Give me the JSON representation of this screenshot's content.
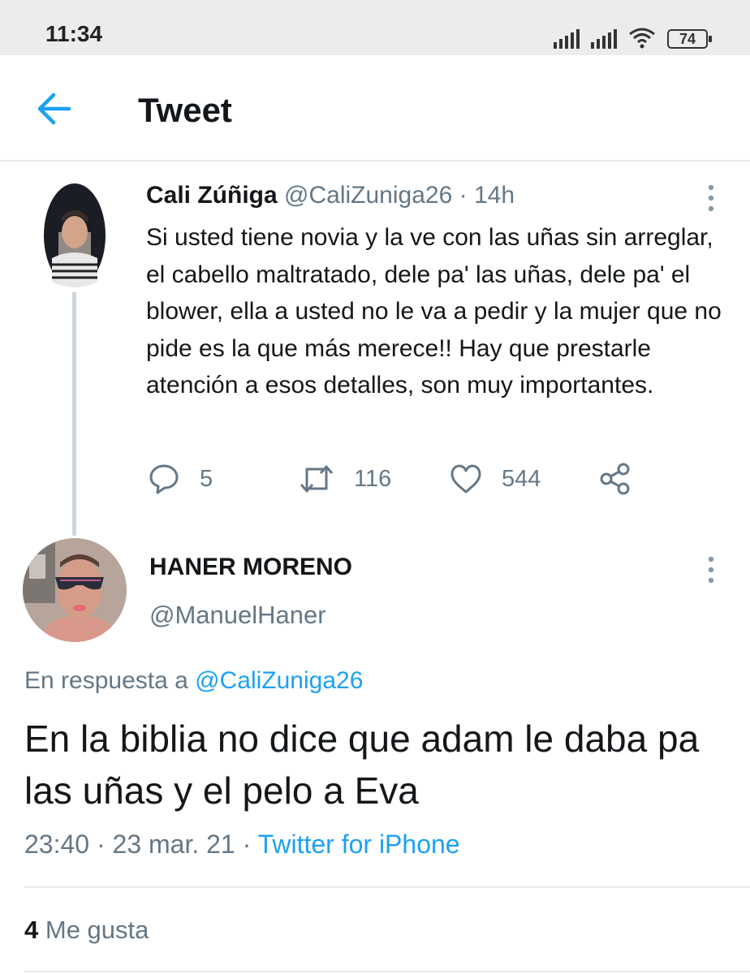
{
  "status_bar": {
    "time": "11:34",
    "battery": "74",
    "icons": [
      "signal-icon",
      "signal-icon",
      "wifi-icon",
      "battery-icon"
    ]
  },
  "header": {
    "title": "Tweet",
    "back_icon": "arrow-left-icon"
  },
  "parent_tweet": {
    "name": "Cali Zúñiga",
    "handle": "@CaliZuniga26",
    "time": "14h",
    "text": "Si usted tiene novia y la ve con las uñas sin arreglar, el cabello maltratado, dele pa' las uñas, dele pa' el blower, ella a usted no le va a pedir y la mujer que no pide es la que más merece!! Hay que prestarle atención a esos detalles, son muy importantes.",
    "replies": "5",
    "retweets": "116",
    "likes": "544"
  },
  "reply_tweet": {
    "name": "HANER MORENO",
    "handle": "@ManuelHaner",
    "replying_prefix": "En respuesta a",
    "replying_mention": "@CaliZuniga26",
    "text": "En la biblia no dice que adam le daba pa las uñas y el pelo a Eva",
    "time": "23:40",
    "date": "23 mar. 21",
    "source": "Twitter for iPhone",
    "like_count": "4",
    "like_label": "Me gusta"
  },
  "colors": {
    "accent": "#1da1f2",
    "secondary_text": "#657786",
    "primary_text": "#14171a",
    "divider": "#e6ecf0"
  }
}
